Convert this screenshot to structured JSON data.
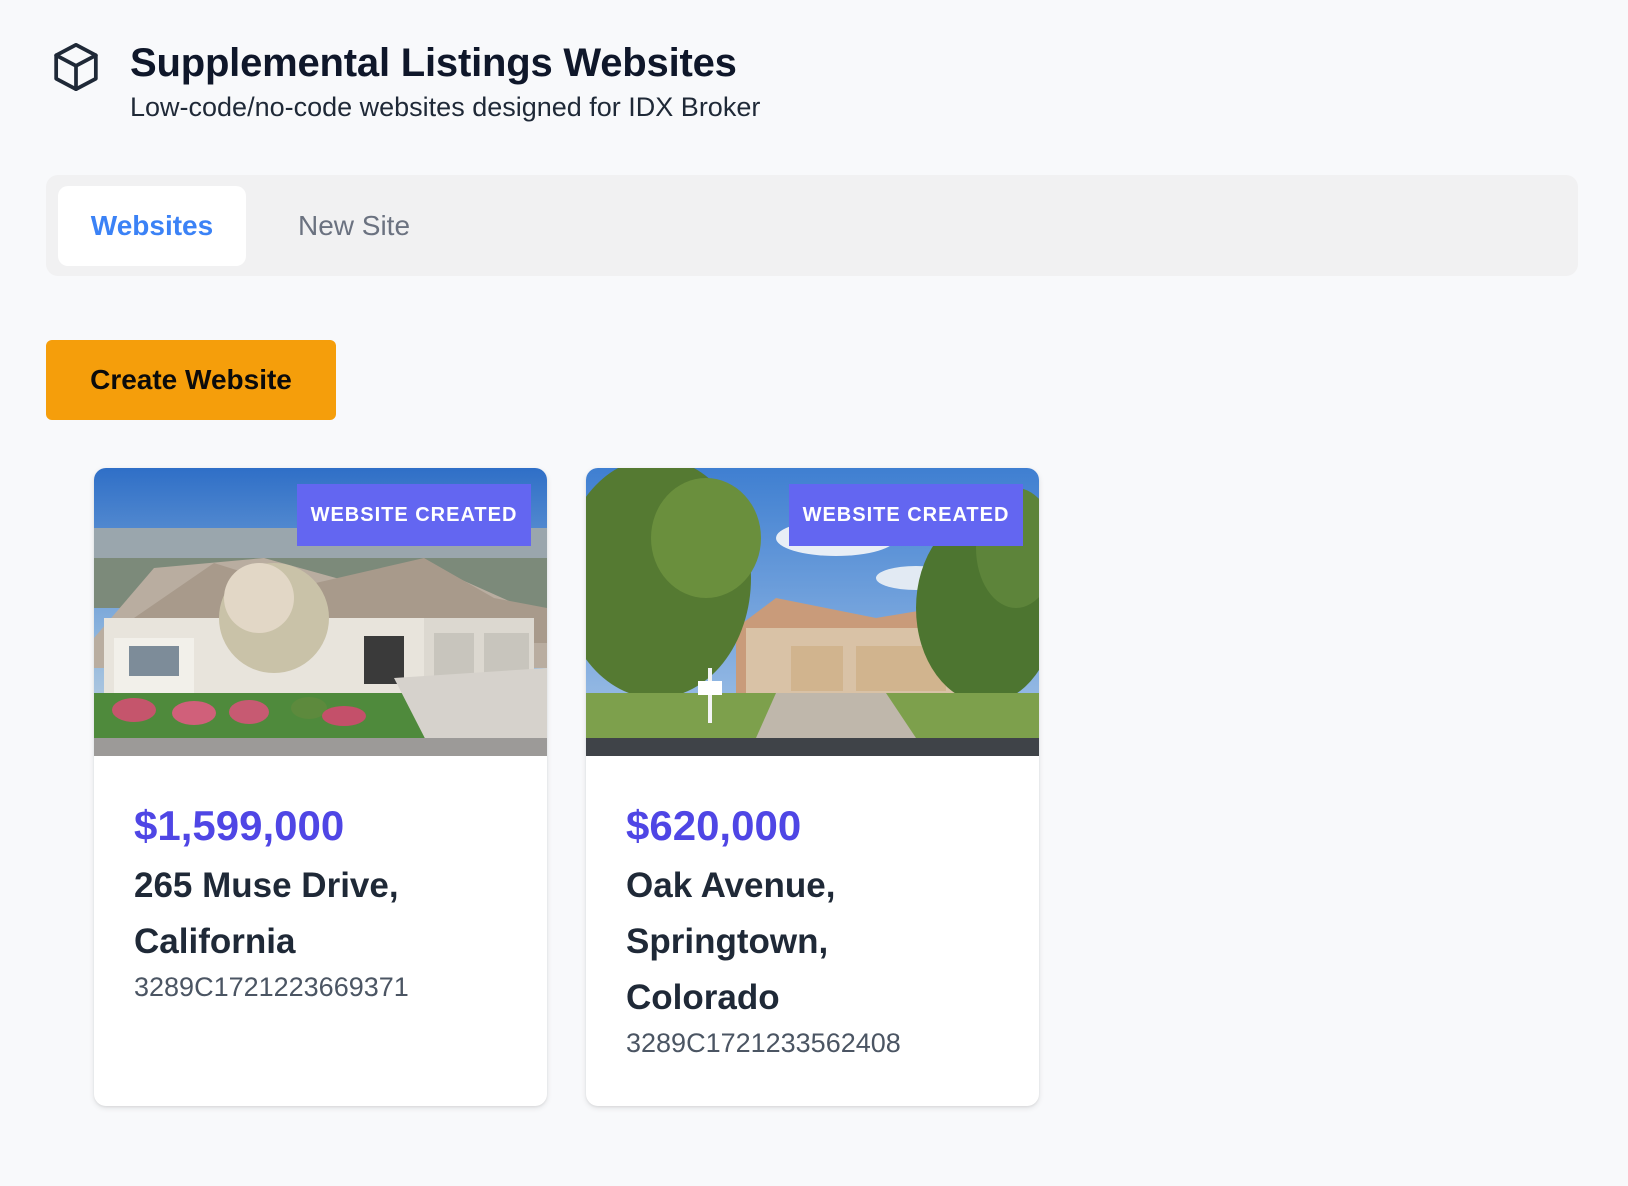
{
  "header": {
    "title": "Supplemental Listings Websites",
    "subtitle": "Low-code/no-code websites designed for IDX Broker",
    "icon": "cube-icon"
  },
  "tabs": [
    {
      "label": "Websites",
      "active": true
    },
    {
      "label": "New Site",
      "active": false
    }
  ],
  "actions": {
    "create_label": "Create Website"
  },
  "colors": {
    "accent": "#3b82f6",
    "button": "#f59e0b",
    "badge": "#6366f1",
    "price": "#4f46e5"
  },
  "listings": [
    {
      "badge": "WEBSITE CREATED",
      "price": "$1,599,000",
      "address_lines": [
        "265 Muse Drive,",
        "California"
      ],
      "listing_id": "3289C1721223669371"
    },
    {
      "badge": "WEBSITE CREATED",
      "price": "$620,000",
      "address_lines": [
        "Oak Avenue,",
        "Springtown,",
        "Colorado"
      ],
      "listing_id": "3289C1721233562408"
    }
  ]
}
